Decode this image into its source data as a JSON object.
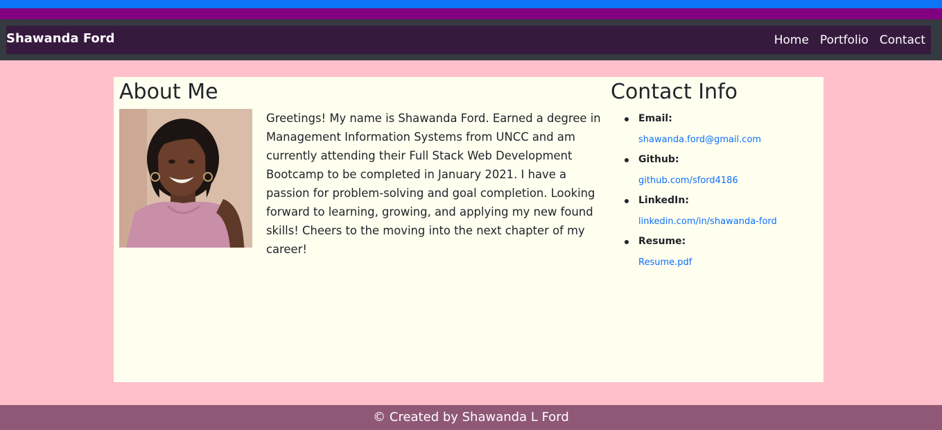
{
  "navbar": {
    "brand": "Shawanda Ford",
    "links": [
      "Home",
      "Portfolio",
      "Contact"
    ]
  },
  "about": {
    "heading": "About Me",
    "bio": "Greetings! My name is Shawanda Ford. Earned a degree in Management Information Systems from UNCC and am currently attending their Full Stack Web Development Bootcamp to be completed in January 2021. I have a passion for problem-solving and goal completion. Looking forward to learning, growing, and applying my new found skills! Cheers to the moving into the next chapter of my career!"
  },
  "contact": {
    "heading": "Contact Info",
    "items": [
      {
        "label": "Email:",
        "value": "shawanda.ford@gmail.com"
      },
      {
        "label": "Github:",
        "value": "github.com/sford4186"
      },
      {
        "label": "LinkedIn:",
        "value": "linkedin.com/in/shawanda-ford"
      },
      {
        "label": "Resume:",
        "value": "Resume.pdf"
      }
    ]
  },
  "footer": {
    "text": "© Created by Shawanda L Ford"
  },
  "colors": {
    "top_stripe_blue": "#0d74f5",
    "top_stripe_purple": "#800080",
    "navbar_bg": "#343a40",
    "navbar_inner": "#361a3e",
    "page_bg": "#ffc0cb",
    "card_bg": "#fffff0",
    "footer_bg": "#8f5877",
    "link": "#0d6efd"
  }
}
